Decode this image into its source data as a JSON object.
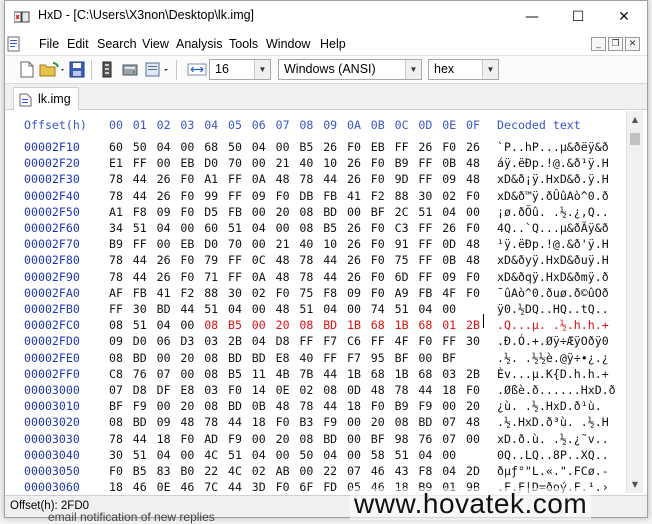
{
  "window": {
    "title": "HxD - [C:\\Users\\X3non\\Desktop\\lk.img]",
    "minimize": "—",
    "maximize": "☐",
    "close": "✕"
  },
  "menu": {
    "items": [
      "File",
      "Edit",
      "Search",
      "View",
      "Analysis",
      "Tools",
      "Window",
      "Help"
    ]
  },
  "toolbar": {
    "bytes_per_row": "16",
    "charset": "Windows (ANSI)",
    "display": "hex"
  },
  "tabs": [
    {
      "label": "lk.img"
    }
  ],
  "editor": {
    "header_offset": "Offset(h)",
    "columns": [
      "00",
      "01",
      "02",
      "03",
      "04",
      "05",
      "06",
      "07",
      "08",
      "09",
      "0A",
      "0B",
      "0C",
      "0D",
      "0E",
      "0F"
    ],
    "header_text": "Decoded text",
    "rows": [
      {
        "offset": "00002F10",
        "hex": [
          "60",
          "50",
          "04",
          "00",
          "68",
          "50",
          "04",
          "00",
          "B5",
          "26",
          "F0",
          "EB",
          "FF",
          "26",
          "F0",
          "26"
        ],
        "text": "`P..hP...µ&ðëÿ&ð"
      },
      {
        "offset": "00002F20",
        "hex": [
          "E1",
          "FF",
          "00",
          "EB",
          "D0",
          "70",
          "00",
          "21",
          "40",
          "10",
          "26",
          "F0",
          "B9",
          "FF",
          "0B",
          "48"
        ],
        "text": "áÿ.ëÐp.!@.&ð¹ÿ.H"
      },
      {
        "offset": "00002F30",
        "hex": [
          "78",
          "44",
          "26",
          "F0",
          "A1",
          "FF",
          "0A",
          "48",
          "78",
          "44",
          "26",
          "F0",
          "9D",
          "FF",
          "09",
          "48"
        ],
        "text": "xD&ð¡ÿ.HxD&ð.ÿ.H"
      },
      {
        "offset": "00002F40",
        "hex": [
          "78",
          "44",
          "26",
          "F0",
          "99",
          "FF",
          "09",
          "F0",
          "DB",
          "FB",
          "41",
          "F2",
          "88",
          "30",
          "02",
          "F0"
        ],
        "text": "xD&ð™ÿ.ðÛûAò^0.ð"
      },
      {
        "offset": "00002F50",
        "hex": [
          "A1",
          "F8",
          "09",
          "F0",
          "D5",
          "FB",
          "00",
          "20",
          "08",
          "BD",
          "00",
          "BF",
          "2C",
          "51",
          "04",
          "00"
        ],
        "text": "¡ø.ðÕû. .½.¿,Q.."
      },
      {
        "offset": "00002F60",
        "hex": [
          "34",
          "51",
          "04",
          "00",
          "60",
          "51",
          "04",
          "00",
          "08",
          "B5",
          "26",
          "F0",
          "C3",
          "FF",
          "26",
          "F0"
        ],
        "text": "4Q..`Q...µ&ðÃÿ&ð"
      },
      {
        "offset": "00002F70",
        "hex": [
          "B9",
          "FF",
          "00",
          "EB",
          "D0",
          "70",
          "00",
          "21",
          "40",
          "10",
          "26",
          "F0",
          "91",
          "FF",
          "0D",
          "48"
        ],
        "text": "¹ÿ.ëÐp.!@.&ð'ÿ.H"
      },
      {
        "offset": "00002F80",
        "hex": [
          "78",
          "44",
          "26",
          "F0",
          "79",
          "FF",
          "0C",
          "48",
          "78",
          "44",
          "26",
          "F0",
          "75",
          "FF",
          "0B",
          "48"
        ],
        "text": "xD&ðyÿ.HxD&ðuÿ.H"
      },
      {
        "offset": "00002F90",
        "hex": [
          "78",
          "44",
          "26",
          "F0",
          "71",
          "FF",
          "0A",
          "48",
          "78",
          "44",
          "26",
          "F0",
          "6D",
          "FF",
          "09",
          "F0"
        ],
        "text": "xD&ðqÿ.HxD&ðmÿ.ð"
      },
      {
        "offset": "00002FA0",
        "hex": [
          "AF",
          "FB",
          "41",
          "F2",
          "88",
          "30",
          "02",
          "F0",
          "75",
          "F8",
          "09",
          "F0",
          "A9",
          "FB",
          "4F",
          "F0"
        ],
        "text": "¯ûAò^0.ðuø.ð©ûOð"
      },
      {
        "offset": "00002FB0",
        "hex": [
          "FF",
          "30",
          "BD",
          "44",
          "51",
          "04",
          "00",
          "48",
          "51",
          "04",
          "00",
          "74",
          "51",
          "04",
          "00"
        ],
        "text": "ÿ0.½DQ..HQ..tQ.."
      },
      {
        "offset": "00002FC0",
        "hex": [
          "08",
          "51",
          "04",
          "00",
          "08",
          "B5",
          "00",
          "20",
          "08",
          "BD",
          "1B",
          "68",
          "1B",
          "68",
          "01",
          "2B"
        ],
        "text": ".Q...µ. .½.h.h.+",
        "sel_from": 4
      },
      {
        "offset": "00002FD0",
        "hex": [
          "09",
          "D0",
          "06",
          "D3",
          "03",
          "2B",
          "04",
          "D8",
          "FF",
          "F7",
          "C6",
          "FF",
          "4F",
          "F0",
          "FF",
          "30"
        ],
        "text": ".Ð.Ó.+.Øÿ÷ÆÿOðÿ0"
      },
      {
        "offset": "00002FE0",
        "hex": [
          "08",
          "BD",
          "00",
          "20",
          "08",
          "BD",
          "BD",
          "E8",
          "40",
          "FF",
          "F7",
          "95",
          "BF",
          "00",
          "BF"
        ],
        "text": ".½. .½½è.@ÿ÷•¿.¿"
      },
      {
        "offset": "00002FF0",
        "hex": [
          "C8",
          "76",
          "07",
          "00",
          "08",
          "B5",
          "11",
          "4B",
          "7B",
          "44",
          "1B",
          "68",
          "1B",
          "68",
          "03",
          "2B"
        ],
        "text": "Èv...µ.K{D.h.h.+"
      },
      {
        "offset": "00003000",
        "hex": [
          "07",
          "D8",
          "DF",
          "E8",
          "03",
          "F0",
          "14",
          "0E",
          "02",
          "08",
          "0D",
          "48",
          "78",
          "44",
          "18",
          "F0"
        ],
        "text": ".Øßè.ð......HxD.ð"
      },
      {
        "offset": "00003010",
        "hex": [
          "BF",
          "F9",
          "00",
          "20",
          "08",
          "BD",
          "0B",
          "48",
          "78",
          "44",
          "18",
          "F0",
          "B9",
          "F9",
          "00",
          "20"
        ],
        "text": "¿ù. .½.HxD.ð¹ù. "
      },
      {
        "offset": "00003020",
        "hex": [
          "08",
          "BD",
          "09",
          "48",
          "78",
          "44",
          "18",
          "F0",
          "B3",
          "F9",
          "00",
          "20",
          "08",
          "BD",
          "07",
          "48"
        ],
        "text": ".½.HxD.ð³ù. .½.H"
      },
      {
        "offset": "00003030",
        "hex": [
          "78",
          "44",
          "18",
          "F0",
          "AD",
          "F9",
          "00",
          "20",
          "08",
          "BD",
          "00",
          "BF",
          "98",
          "76",
          "07",
          "00"
        ],
        "text": "xD.ð.ù. .½.¿˜v.."
      },
      {
        "offset": "00003040",
        "hex": [
          "30",
          "51",
          "04",
          "00",
          "4C",
          "51",
          "04",
          "00",
          "50",
          "04",
          "00",
          "58",
          "51",
          "04",
          "00"
        ],
        "text": "0Q..LQ..8P..XQ.."
      },
      {
        "offset": "00003050",
        "hex": [
          "F0",
          "B5",
          "83",
          "B0",
          "22",
          "4C",
          "02",
          "AB",
          "00",
          "22",
          "07",
          "46",
          "43",
          "F8",
          "04",
          "2D"
        ],
        "text": "ðµƒ°\"L.«.\".FCø.-"
      },
      {
        "offset": "00003060",
        "hex": [
          "18",
          "46",
          "0E",
          "46",
          "7C",
          "44",
          "3D",
          "F0",
          "6F",
          "FD",
          "05",
          "46",
          "18",
          "B9",
          "01",
          "9B"
        ],
        "text": ".F.F|D=ðoý.F.¹.›"
      }
    ]
  },
  "status": {
    "offset": "Offset(h): 2FD0"
  },
  "background": {
    "watermark": "www.hovatek.com",
    "behind_text": "email notification of new replies"
  }
}
